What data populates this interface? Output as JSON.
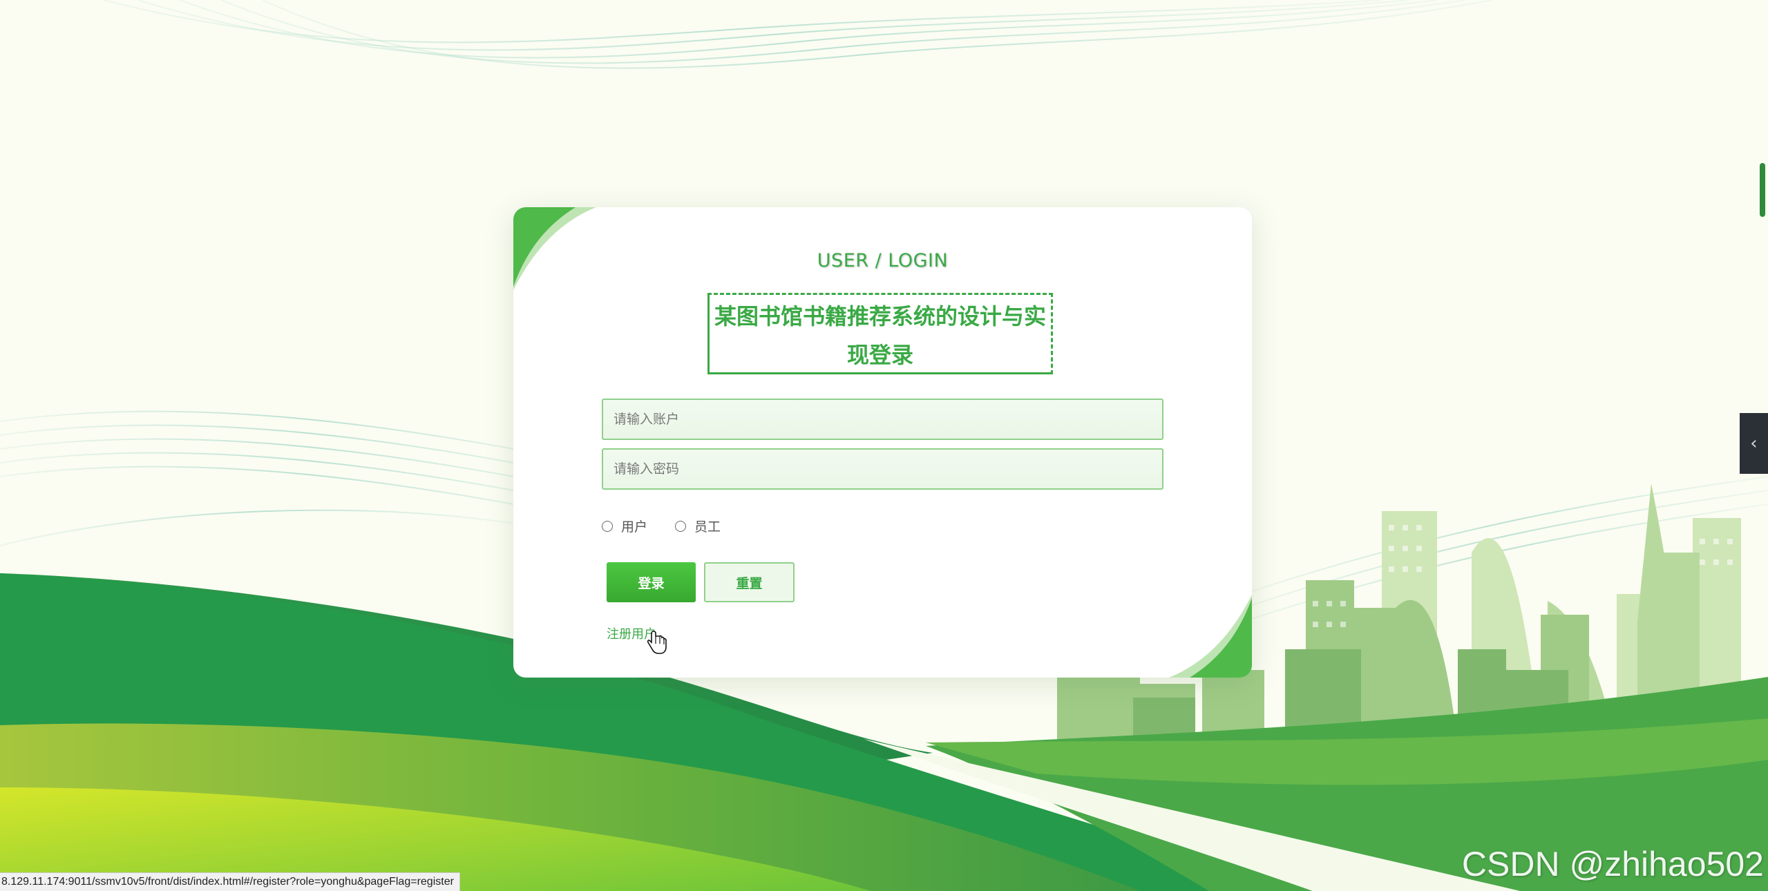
{
  "login": {
    "subtitle": "USER / LOGIN",
    "title": "某图书馆书籍推荐系统的设计与实现登录",
    "account_placeholder": "请输入账户",
    "password_placeholder": "请输入密码",
    "roles": [
      {
        "label": "用户"
      },
      {
        "label": "员工"
      }
    ],
    "login_button": "登录",
    "reset_button": "重置",
    "register_link": "注册用户"
  },
  "status_bar": {
    "url": "8.129.11.174:9011/ssmv10v5/front/dist/index.html#/register?role=yonghu&pageFlag=register"
  },
  "watermark": "CSDN @zhihao502",
  "side_toggle": {
    "icon": "chevron-left-icon"
  },
  "colors": {
    "accent": "#3aa945",
    "button": "#37a92f",
    "background": "#fbfcf2"
  }
}
